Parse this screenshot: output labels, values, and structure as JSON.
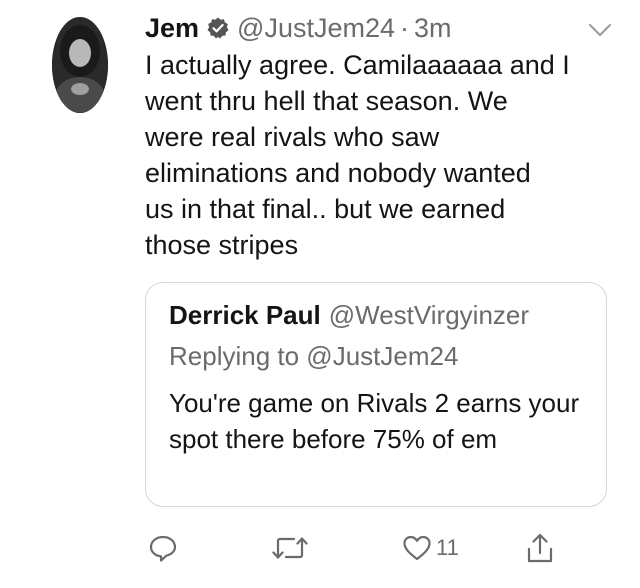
{
  "tweet": {
    "author_name": "Jem",
    "author_handle": "@JustJem24",
    "separator": "·",
    "time": "3m",
    "text": "I actually agree. Camilaaaaaa and I\nwent thru hell that season. We\nwere real rivals who saw\neliminations and nobody wanted\nus in that final.. but we earned\nthose stripes"
  },
  "quote": {
    "author_name": "Derrick Paul",
    "author_handle": "@WestVirgyinzer",
    "replying_to": "Replying to @JustJem24",
    "text": "You're game on Rivals 2 earns your spot there before 75% of em"
  },
  "actions": {
    "like_count": "11"
  },
  "icons": {
    "verified": "verified-badge-icon",
    "menu": "chevron-down-icon",
    "reply": "reply-icon",
    "retweet": "retweet-icon",
    "like": "heart-icon",
    "share": "share-icon"
  }
}
